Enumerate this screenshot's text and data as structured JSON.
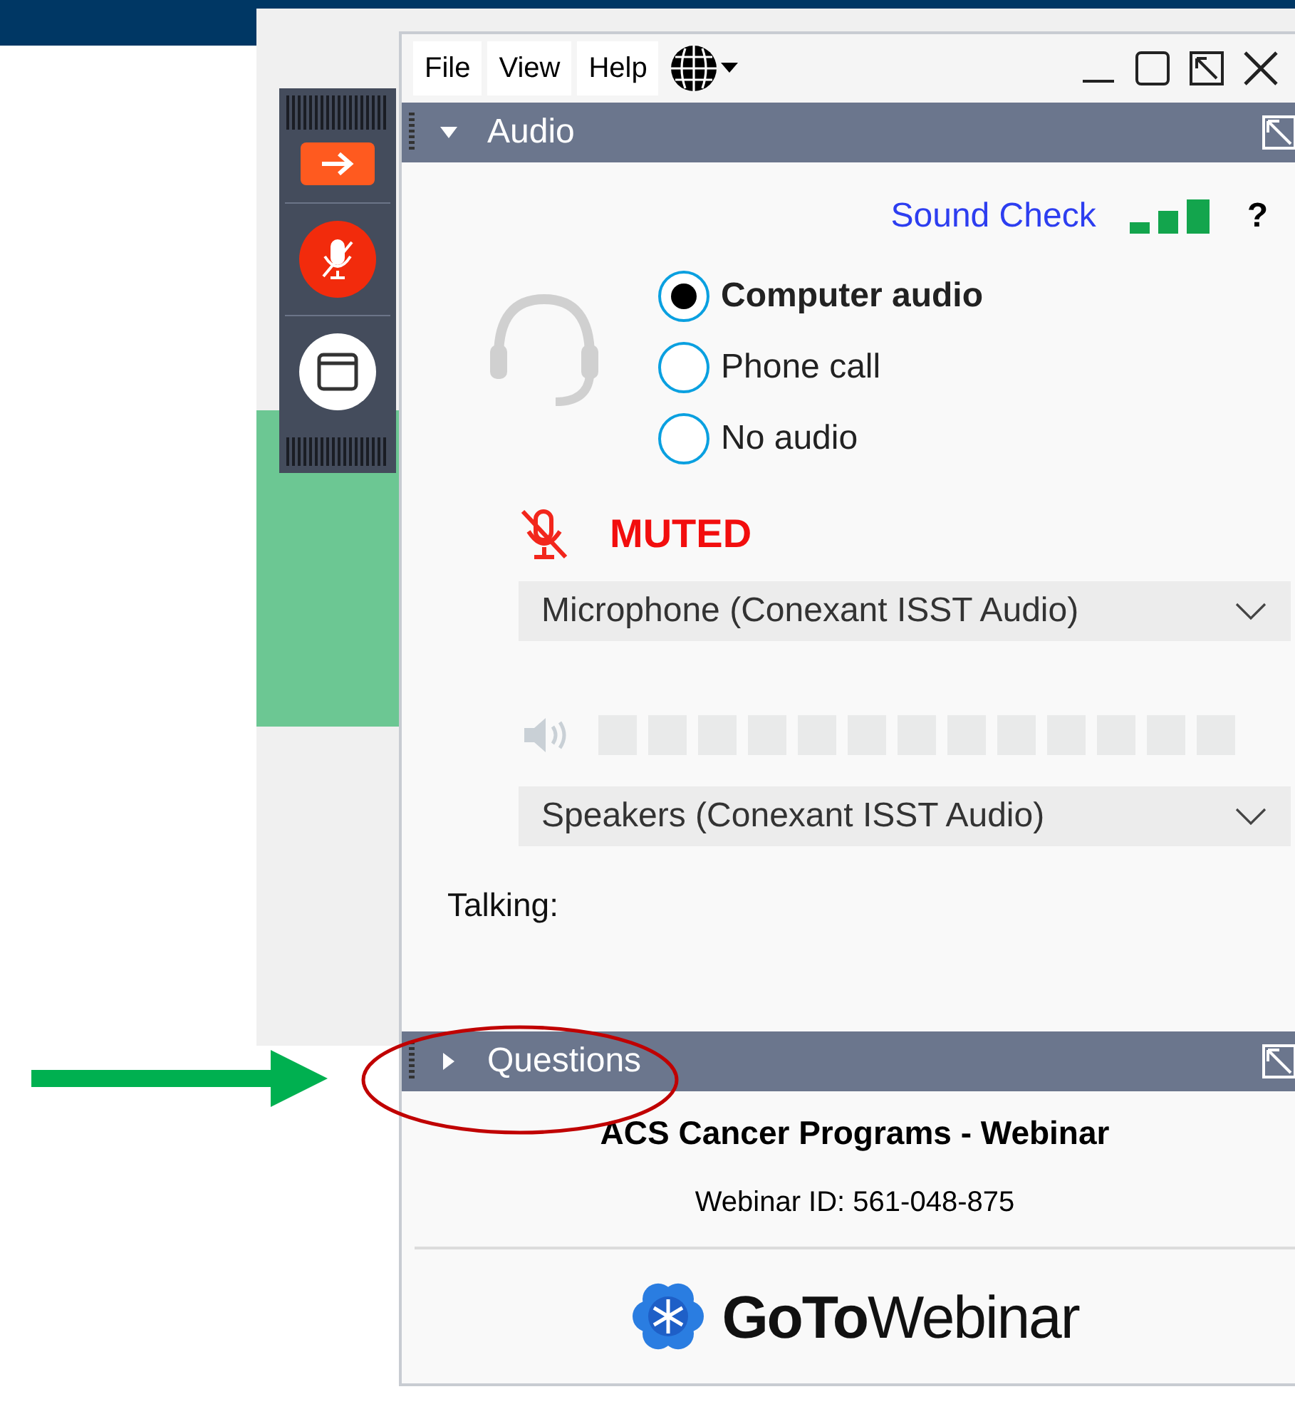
{
  "menu": [
    {
      "label": "File"
    },
    {
      "label": "View"
    },
    {
      "label": "Help"
    }
  ],
  "toolbar": {
    "mic_muted": true
  },
  "audio_section": {
    "title": "Audio",
    "expanded": true,
    "sound_check": "Sound Check",
    "help": "?",
    "options": [
      {
        "label": "Computer audio",
        "selected": true
      },
      {
        "label": "Phone call",
        "selected": false
      },
      {
        "label": "No audio",
        "selected": false
      }
    ],
    "mute_status": "MUTED",
    "microphone": "Microphone (Conexant ISST Audio)",
    "speaker_meter": {
      "level": 0
    },
    "speakers": "Speakers (Conexant ISST Audio)",
    "talking_label": "Talking:"
  },
  "questions_section": {
    "title": "Questions",
    "expanded": false
  },
  "webinar": {
    "title": "ACS Cancer Programs - Webinar",
    "id": "Webinar ID: 561-048-875",
    "logo": "**GoTo**Webinar"
  }
}
